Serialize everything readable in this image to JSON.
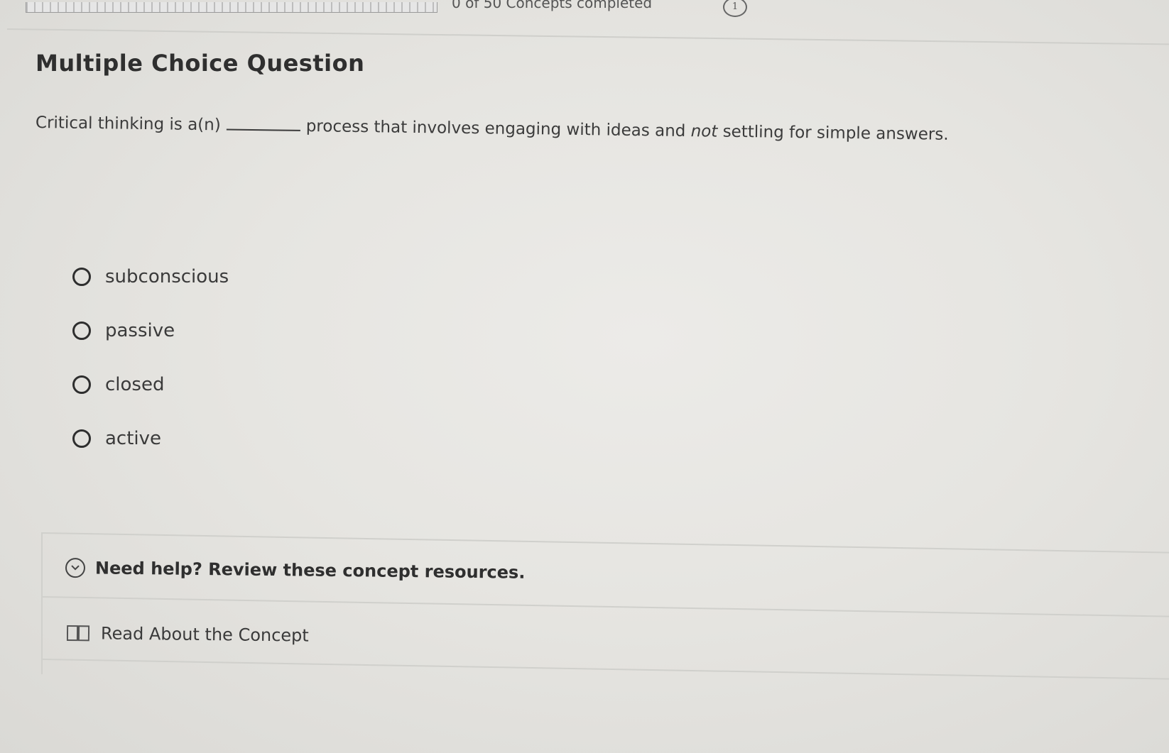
{
  "header": {
    "progress_text": "0 of 50 Concepts completed",
    "info_badge": "1"
  },
  "question": {
    "type_title": "Multiple Choice Question",
    "text_before": "Critical thinking is a(n)",
    "text_middle": "process that involves engaging with ideas and ",
    "text_emphasis": "not",
    "text_after": " settling for simple answers."
  },
  "choices": [
    {
      "label": "subconscious",
      "selected": false
    },
    {
      "label": "passive",
      "selected": false
    },
    {
      "label": "closed",
      "selected": false
    },
    {
      "label": "active",
      "selected": false
    }
  ],
  "help": {
    "title": "Need help? Review these concept resources.",
    "resources": [
      {
        "label": "Read About the Concept",
        "icon": "book-icon"
      }
    ]
  }
}
